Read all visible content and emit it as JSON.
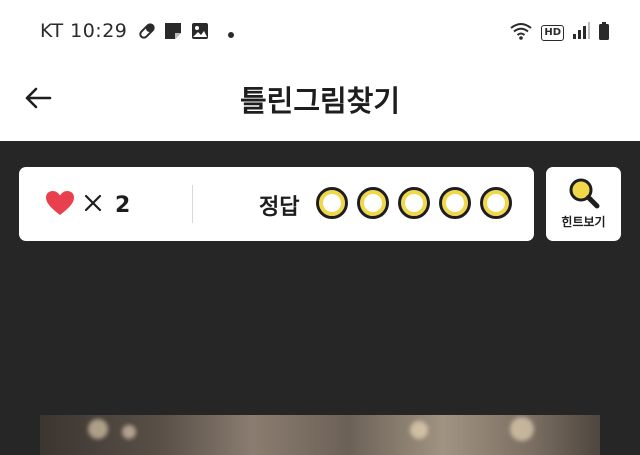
{
  "status_bar": {
    "carrier_time": "KT 10:29",
    "hd_badge": "HD",
    "icons_left": [
      "pill-icon",
      "note-icon",
      "image-icon",
      "dot-icon"
    ],
    "icons_right": [
      "wifi-icon",
      "hd-icon",
      "signal-icon",
      "battery-icon"
    ]
  },
  "app_bar": {
    "title": "틀린그림찾기",
    "back_icon": "arrow-left-icon"
  },
  "score_card": {
    "heart_icon": "heart-icon",
    "times_symbol": "×",
    "lives_count": "2",
    "answer_label": "정답",
    "answer_slots_total": 5,
    "answer_slots_found": 0
  },
  "hint_button": {
    "label": "힌트보기",
    "icon": "magnifier-icon"
  },
  "colors": {
    "background": "#262626",
    "heart": "#e8414d",
    "slot_ring": "#f1d84a",
    "hint_icon": "#f1d84a"
  }
}
